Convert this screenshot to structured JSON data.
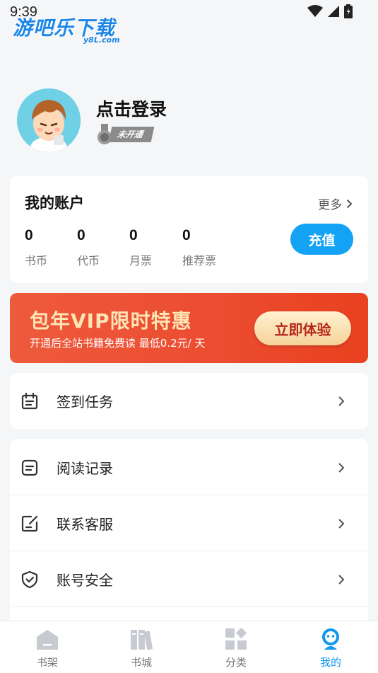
{
  "status_bar": {
    "time": "9:39"
  },
  "watermark": {
    "name": "游吧乐下载",
    "domain": "y8L.com"
  },
  "profile": {
    "login_text": "点击登录",
    "vip_status": "未开通"
  },
  "account": {
    "title": "我的账户",
    "more_label": "更多",
    "stats": [
      {
        "value": "0",
        "label": "书币"
      },
      {
        "value": "0",
        "label": "代币"
      },
      {
        "value": "0",
        "label": "月票"
      },
      {
        "value": "0",
        "label": "推荐票"
      }
    ],
    "recharge_label": "充值"
  },
  "vip_banner": {
    "title": "包年VIP限时特惠",
    "subtitle": "开通后全站书籍免费读 最低0.2元/ 天",
    "button_label": "立即体验"
  },
  "menu": {
    "sign_in": "签到任务",
    "reading_history": "阅读记录",
    "customer_service": "联系客服",
    "account_security": "账号安全"
  },
  "tabs": [
    {
      "label": "书架",
      "icon": "bookshelf-icon"
    },
    {
      "label": "书城",
      "icon": "bookstore-icon"
    },
    {
      "label": "分类",
      "icon": "category-icon"
    },
    {
      "label": "我的",
      "icon": "profile-icon",
      "active": true
    }
  ],
  "colors": {
    "accent": "#14a3f4",
    "tab_active": "#1297ee",
    "banner": "#ec4d31",
    "banner_button_text": "#b5291c"
  }
}
